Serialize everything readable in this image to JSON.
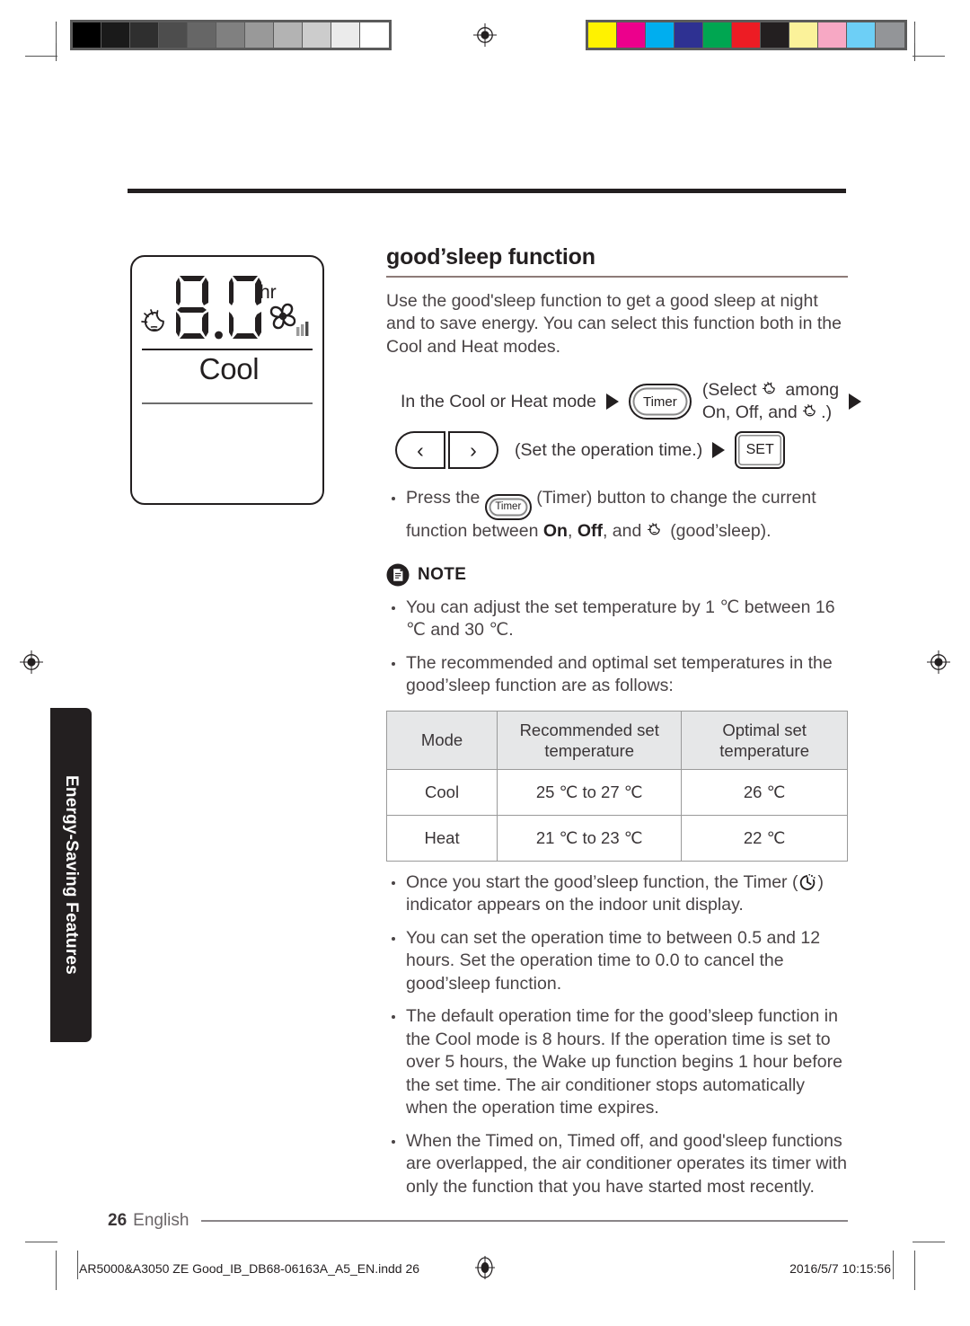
{
  "calibration": {
    "gray_swatches": [
      "#000000",
      "#1a1a1a",
      "#2f2f2f",
      "#4d4d4d",
      "#666666",
      "#808080",
      "#999999",
      "#b3b3b3",
      "#cccccc",
      "#ebebeb",
      "#ffffff"
    ],
    "color_swatches": [
      "#fff200",
      "#ec008c",
      "#00aeef",
      "#2e3192",
      "#00a651",
      "#ed1c24",
      "#231f20",
      "#fbf29a",
      "#f7a8c4",
      "#6dcff6",
      "#939598"
    ]
  },
  "sidebar": {
    "tab_label": "Energy-Saving Features"
  },
  "display": {
    "value": "8.0",
    "unit": "hr",
    "mode": "Cool",
    "sleep_icon": "goodsleep-icon",
    "fan_icon": "fan-icon"
  },
  "section": {
    "title": "good’sleep function",
    "intro": "Use the good'sleep function to get a good sleep at night and to save energy. You can select this function both in the Cool and Heat modes."
  },
  "steps": {
    "line1_text": "In the Cool or Heat mode",
    "timer_button": "Timer",
    "select_line1": "(Select",
    "select_line1_tail": "among",
    "select_line2": "On, Off, and",
    "select_line2_tail": ".)",
    "arrow_left": "‹",
    "arrow_right": "›",
    "set_time_text": "(Set the operation time.)",
    "set_button": "SET"
  },
  "press_bullet": {
    "part1": "Press the",
    "timer_label": "Timer",
    "part2": "(Timer) button to change the current function between",
    "on": "On",
    "comma": ",",
    "off": "Off",
    "part3": ", and",
    "part4": "(good’sleep)."
  },
  "note": {
    "label": "NOTE",
    "bullets_before_table": [
      "You can adjust the set temperature by 1 ℃ between 16 ℃ and 30 ℃.",
      "The recommended and optimal set temperatures in the good’sleep function are as follows:"
    ]
  },
  "table": {
    "headers": [
      "Mode",
      "Recommended set temperature",
      "Optimal set temperature"
    ],
    "rows": [
      [
        "Cool",
        "25 ℃ to 27 ℃",
        "26 ℃"
      ],
      [
        "Heat",
        "21 ℃ to 23 ℃",
        "22 ℃"
      ]
    ]
  },
  "bullets_after_table": {
    "timer_indicator_pre": "Once you start the good’sleep function, the Timer (",
    "timer_indicator_post": ") indicator appears on the indoor unit display.",
    "items": [
      "You can set the operation time to between 0.5 and 12 hours. Set the operation time to 0.0 to cancel the good’sleep function.",
      "The default operation time for the good’sleep function in the Cool mode is 8 hours. If the operation time is set to over 5 hours, the Wake up function begins 1 hour before the set time. The air conditioner stops automatically when the operation time expires.",
      "When the Timed on, Timed off, and good'sleep functions are overlapped, the air conditioner operates its timer with only the function that you have started most recently."
    ]
  },
  "footer": {
    "page_number": "26",
    "language": "English",
    "imprint_file": "AR5000&A3050 ZE Good_IB_DB68-06163A_A5_EN.indd   26",
    "imprint_date": "2016/5/7   10:15:56"
  }
}
